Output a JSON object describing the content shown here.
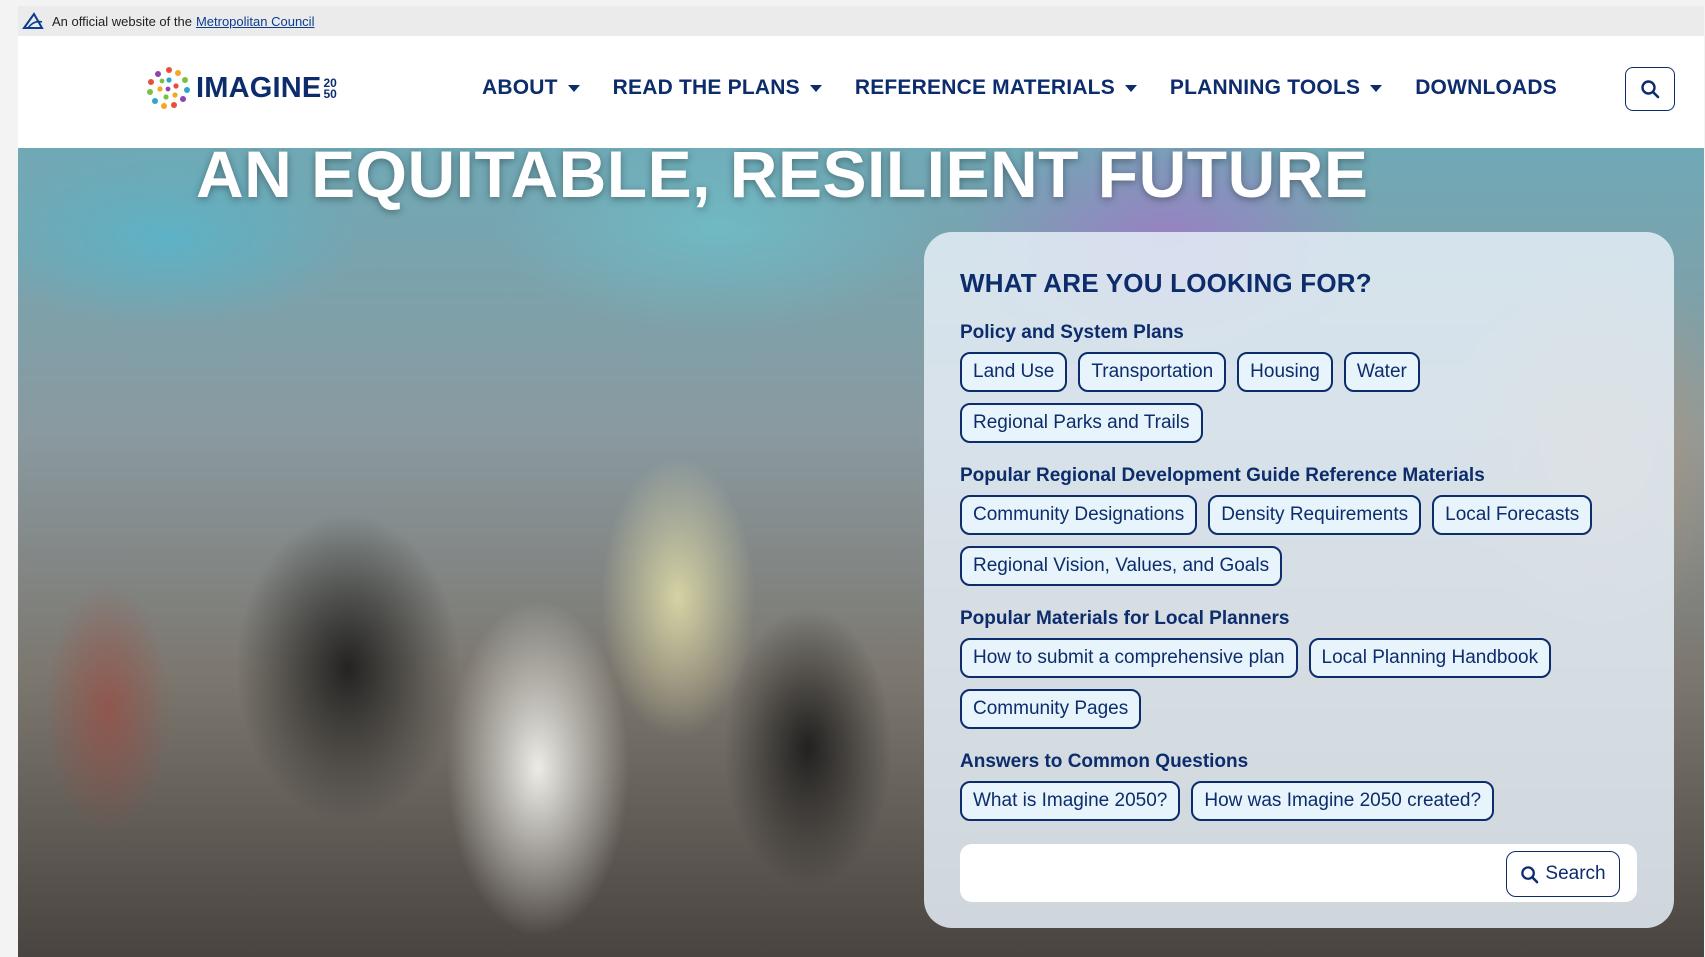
{
  "official_bar": {
    "prefix": "An official website of the",
    "link": "Metropolitan Council"
  },
  "logo": {
    "word": "IMAGINE",
    "year_top": "20",
    "year_bottom": "50"
  },
  "nav": {
    "items": [
      {
        "label": "ABOUT",
        "has_dropdown": true
      },
      {
        "label": "READ THE PLANS",
        "has_dropdown": true
      },
      {
        "label": "REFERENCE MATERIALS",
        "has_dropdown": true
      },
      {
        "label": "PLANNING TOOLS",
        "has_dropdown": true
      },
      {
        "label": "DOWNLOADS",
        "has_dropdown": false
      }
    ],
    "search_icon": "search-icon"
  },
  "hero": {
    "title": "AN EQUITABLE, RESILIENT FUTURE"
  },
  "finder": {
    "title": "WHAT ARE YOU LOOKING FOR?",
    "sections": [
      {
        "heading": "Policy and System Plans",
        "chips": [
          "Land Use",
          "Transportation",
          "Housing",
          "Water",
          "Regional Parks and Trails"
        ]
      },
      {
        "heading": "Popular Regional Development Guide Reference Materials",
        "chips": [
          "Community Designations",
          "Density Requirements",
          "Local Forecasts",
          "Regional Vision, Values, and Goals"
        ]
      },
      {
        "heading": "Popular Materials for Local Planners",
        "chips": [
          "How to submit a comprehensive plan",
          "Local Planning Handbook",
          "Community Pages"
        ]
      },
      {
        "heading": "Answers to Common Questions",
        "chips": [
          "What is Imagine 2050?",
          "How was Imagine 2050 created?"
        ]
      }
    ],
    "search": {
      "placeholder": "",
      "button_label": "Search"
    }
  },
  "colors": {
    "navy": "#0d2c6c",
    "chip_bg": "#e7f4fb",
    "panel_bg": "#e4eef6"
  }
}
